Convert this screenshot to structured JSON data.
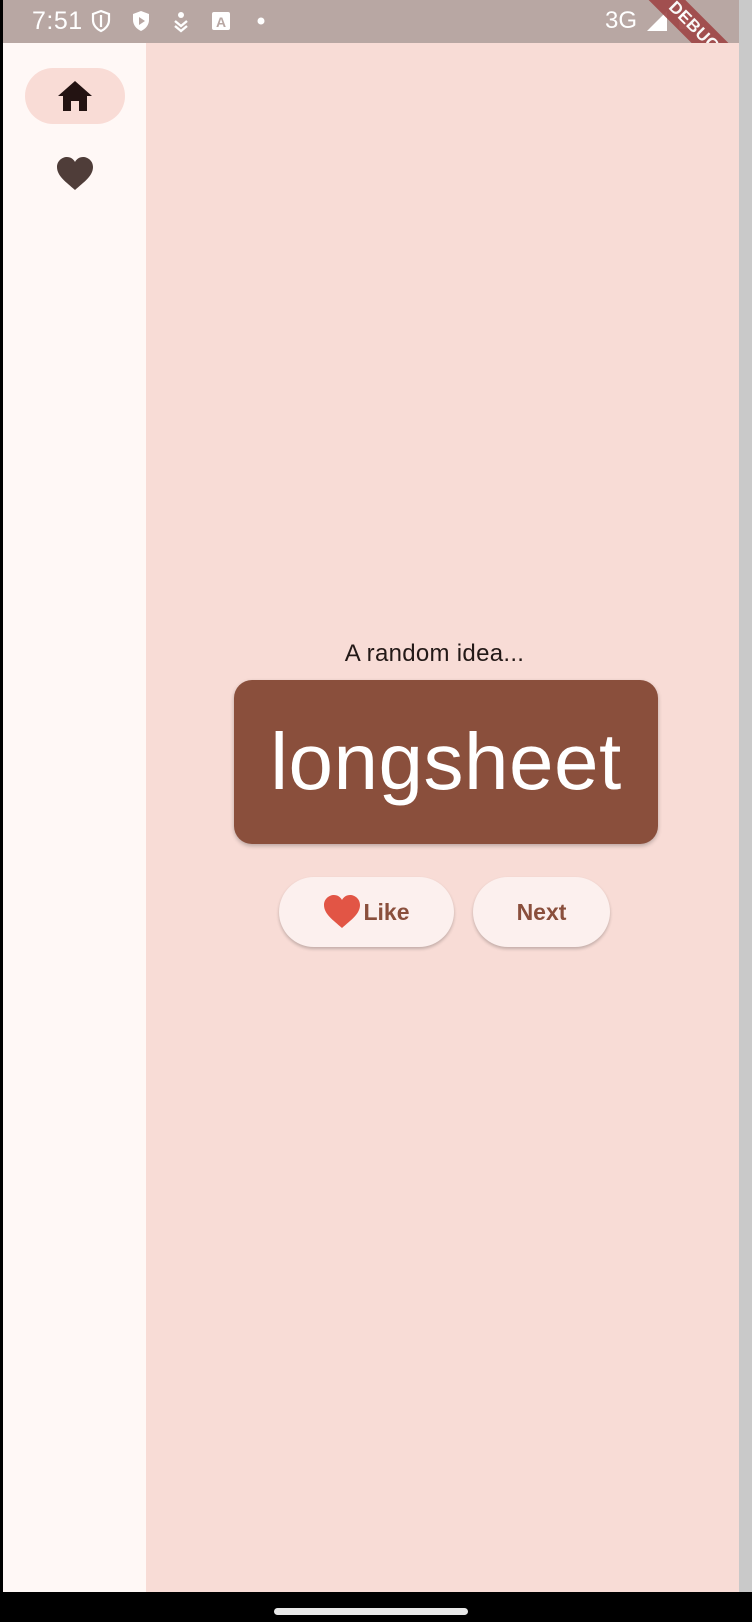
{
  "status_bar": {
    "time": "7:51",
    "network": "3G",
    "icons": [
      "shield-icon",
      "play-protect-icon",
      "download-icon",
      "text-a-icon",
      "dot-icon",
      "signal-icon",
      "battery-icon"
    ],
    "debug_label": "DEBUG"
  },
  "nav_rail": {
    "items": [
      {
        "name": "home",
        "icon": "home-icon",
        "selected": true
      },
      {
        "name": "favorites",
        "icon": "heart-icon",
        "selected": false
      }
    ]
  },
  "main": {
    "subtitle": "A random idea...",
    "word": "longsheet",
    "like_label": "Like",
    "next_label": "Next"
  },
  "colors": {
    "background": "#f8dcd6",
    "rail": "#fff8f6",
    "card": "#8a4f3c",
    "heart": "#e25545",
    "button": "#fcf0ee"
  }
}
